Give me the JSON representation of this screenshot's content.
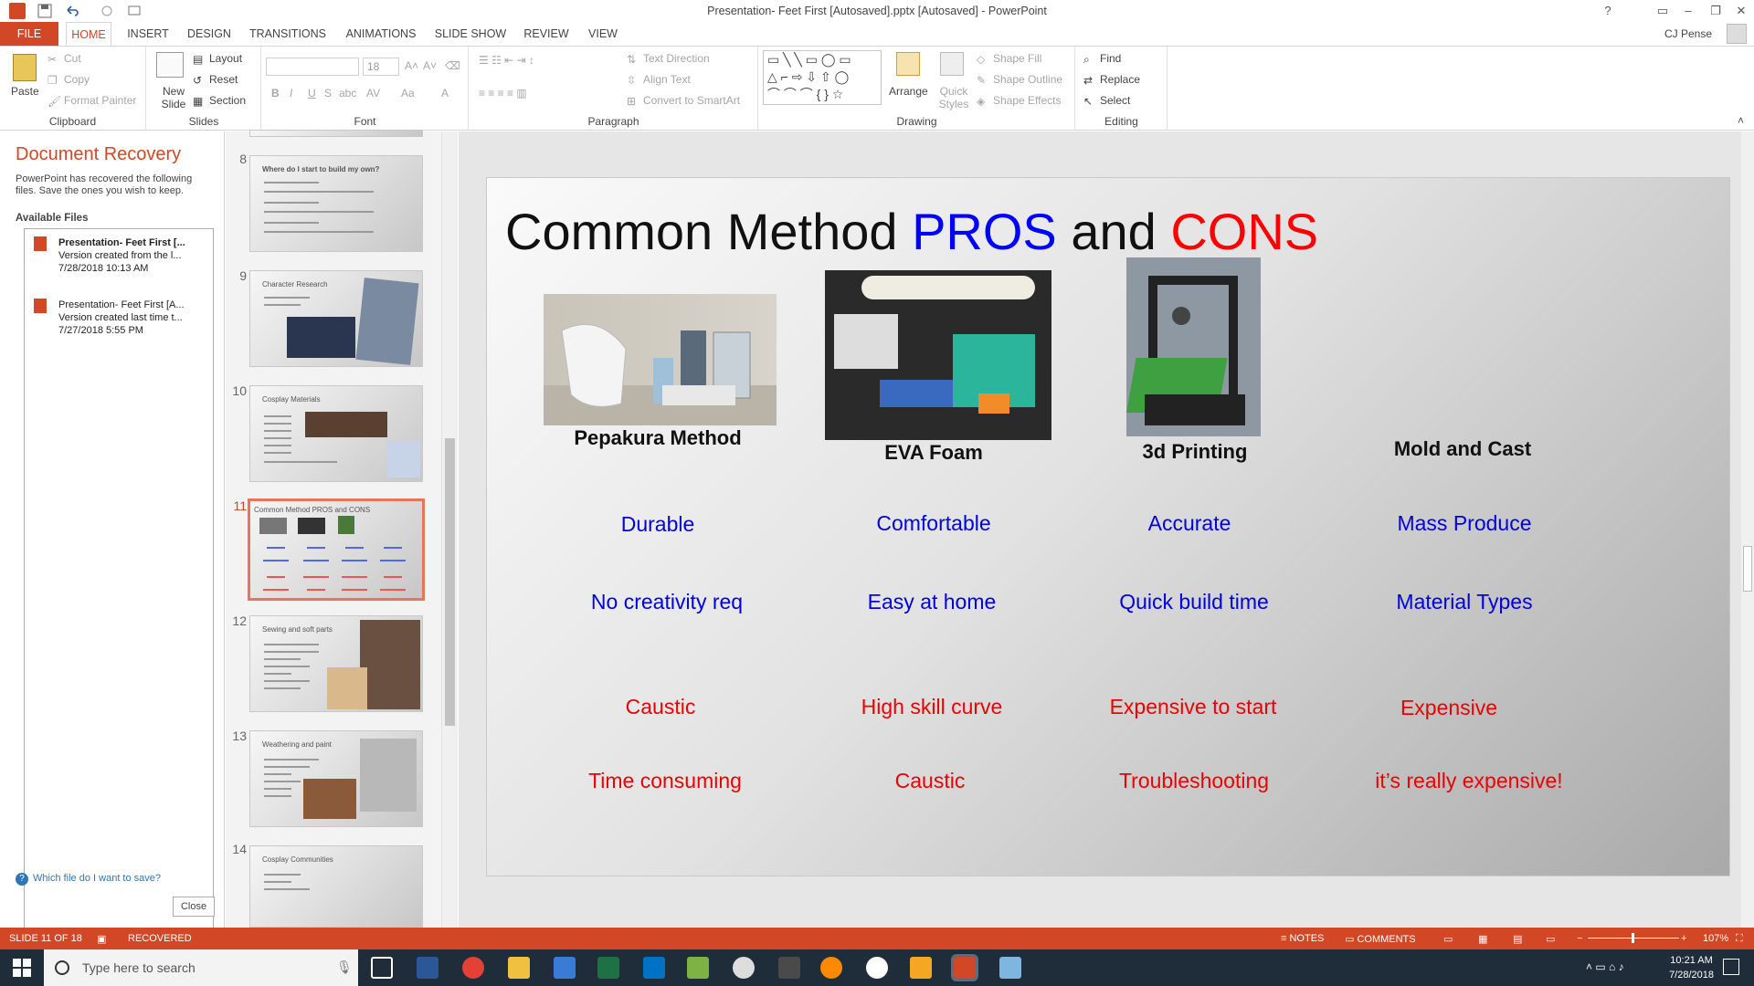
{
  "window": {
    "title": "Presentation- Feet First [Autosaved].pptx [Autosaved] - PowerPoint",
    "help": "?",
    "user": "CJ Pense"
  },
  "tabs": [
    "FILE",
    "HOME",
    "INSERT",
    "DESIGN",
    "TRANSITIONS",
    "ANIMATIONS",
    "SLIDE SHOW",
    "REVIEW",
    "VIEW"
  ],
  "ribbon": {
    "clipboard": {
      "paste": "Paste",
      "cut": "Cut",
      "copy": "Copy",
      "format_painter": "Format Painter",
      "label": "Clipboard"
    },
    "slides": {
      "new_slide": "New Slide",
      "layout": "Layout",
      "reset": "Reset",
      "section": "Section",
      "label": "Slides"
    },
    "font": {
      "size": "18",
      "label": "Font",
      "bold": "B",
      "italic": "I",
      "underline": "U",
      "strike": "S",
      "shadow": "abc",
      "spacing": "AV",
      "case": "Aa",
      "color": "A"
    },
    "paragraph": {
      "text_direction": "Text Direction",
      "align_text": "Align Text",
      "convert_smartart": "Convert to SmartArt",
      "label": "Paragraph"
    },
    "drawing": {
      "arrange": "Arrange",
      "quick_styles": "Quick Styles",
      "shape_fill": "Shape Fill",
      "shape_outline": "Shape Outline",
      "shape_effects": "Shape Effects",
      "label": "Drawing"
    },
    "editing": {
      "find": "Find",
      "replace": "Replace",
      "select": "Select",
      "label": "Editing"
    }
  },
  "recovery": {
    "title": "Document Recovery",
    "description": "PowerPoint has recovered the following files.  Save the ones you wish to keep.",
    "available_label": "Available Files",
    "files": [
      {
        "name": "Presentation- Feet First [...",
        "desc": "Version created from the l...",
        "date": "7/28/2018 10:13 AM"
      },
      {
        "name": "Presentation- Feet First [A...",
        "desc": "Version created last time t...",
        "date": "7/27/2018 5:55 PM"
      }
    ],
    "help_link": "Which file do I want to save?",
    "close": "Close"
  },
  "thumbnails": [
    {
      "num": "8",
      "title": "Where do I start to build my own?"
    },
    {
      "num": "9",
      "title": "Character Research"
    },
    {
      "num": "10",
      "title": "Cosplay Materials"
    },
    {
      "num": "11",
      "title": "Common Method PROS and CONS"
    },
    {
      "num": "12",
      "title": "Sewing and soft parts"
    },
    {
      "num": "13",
      "title": "Weathering and paint"
    },
    {
      "num": "14",
      "title": "Cosplay Communities"
    }
  ],
  "slide": {
    "title_a": "Common Method ",
    "title_pros": "PROS",
    "title_and": " and ",
    "title_cons": "CONS",
    "methods": [
      "Pepakura Method",
      "EVA Foam",
      "3d Printing",
      "Mold and Cast"
    ],
    "pros_row1": [
      "Durable",
      "Comfortable",
      "Accurate",
      "Mass Produce"
    ],
    "pros_row2": [
      "No creativity req",
      "Easy at home",
      "Quick build time",
      "Material Types"
    ],
    "cons_row1": [
      "Caustic",
      "High skill curve",
      "Expensive to start",
      "Expensive"
    ],
    "cons_row2": [
      "Time consuming",
      "Caustic",
      "Troubleshooting",
      "it’s really expensive!"
    ],
    "colors": {
      "pros": "#0000ff",
      "cons": "#ff0000"
    }
  },
  "status": {
    "slide": "SLIDE 11 OF 18",
    "recovered": "RECOVERED",
    "notes": "NOTES",
    "comments": "COMMENTS",
    "zoom": "107%"
  },
  "taskbar": {
    "search": "Type here to search",
    "time": "10:21 AM",
    "date": "7/28/2018"
  }
}
